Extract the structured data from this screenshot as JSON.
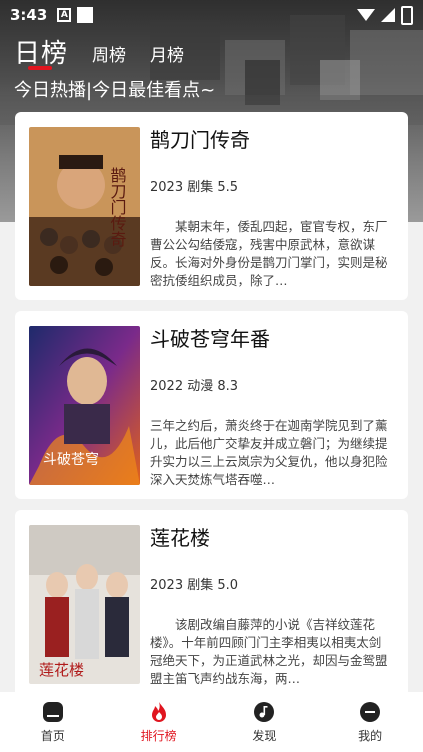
{
  "status_bar": {
    "time": "3:43",
    "a_label": "A"
  },
  "header": {
    "tabs": [
      {
        "label": "日榜"
      },
      {
        "label": "周榜"
      },
      {
        "label": "月榜"
      }
    ],
    "subtitle": "今日热播|今日最佳看点~",
    "accent": "#e0151f"
  },
  "list": [
    {
      "title": "鹊刀门传奇",
      "meta": "2023 剧集 5.5",
      "desc": "某朝末年，倭乱四起，宦官专权，东厂曹公公勾结倭寇，残害中原武林，意欲谋反。长海对外身份是鹊刀门掌门，实则是秘密抗倭组织成员，除了…",
      "poster_text": "鹊刀门传奇"
    },
    {
      "title": "斗破苍穹年番",
      "meta": "2022 动漫 8.3",
      "desc": "三年之约后，萧炎终于在迦南学院见到了薰儿，此后他广交挚友并成立磐门；为继续提升实力以三上云岚宗为父复仇，他以身犯险深入天焚炼气塔吞噬…",
      "poster_text": "斗破苍穹"
    },
    {
      "title": "莲花楼",
      "meta": "2023 剧集 5.0",
      "desc": "该剧改编自藤萍的小说《吉祥纹莲花楼》。十年前四顾门门主李相夷以相夷太剑冠绝天下，为正道武林之光，却因与金鸳盟盟主笛飞声约战东海，两…",
      "poster_text": "莲花楼"
    }
  ],
  "bottom_nav": [
    {
      "label": "首页",
      "icon": "home-icon"
    },
    {
      "label": "排行榜",
      "icon": "fire-icon"
    },
    {
      "label": "发现",
      "icon": "music-icon"
    },
    {
      "label": "我的",
      "icon": "profile-icon"
    }
  ]
}
